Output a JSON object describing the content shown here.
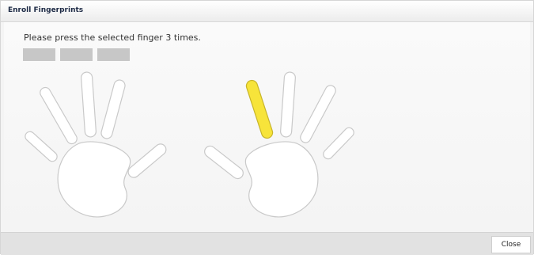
{
  "dialog": {
    "title": "Enroll Fingerprints",
    "instruction": "Please press the selected finger 3 times.",
    "progress": {
      "total_presses": 3,
      "completed_presses": 0
    },
    "close_label": "Close"
  },
  "hands": {
    "left": [
      "pinky",
      "ring",
      "middle",
      "index",
      "thumb"
    ],
    "right": [
      "thumb",
      "index",
      "middle",
      "ring",
      "pinky"
    ],
    "selected_finger": "right-index"
  },
  "colors": {
    "finger_fill": "#ffffff",
    "finger_outline": "#c9c9c9",
    "selected_fill": "#f7e43a",
    "selected_outline": "#c8b52a",
    "progress_empty": "#c7c7c7",
    "title_text": "#1d2a45"
  }
}
